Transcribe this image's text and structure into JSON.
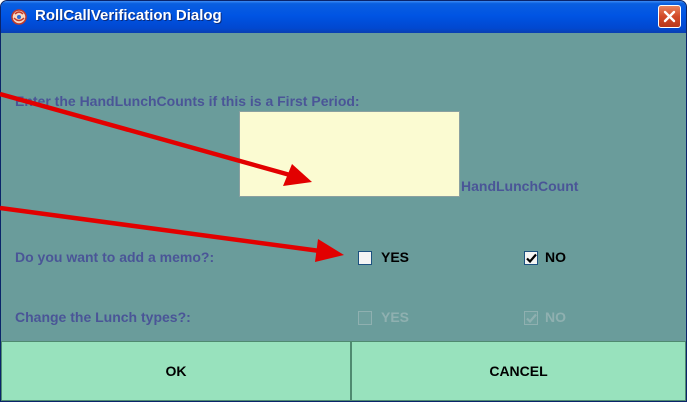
{
  "window": {
    "title": "RollCallVerification Dialog"
  },
  "prompt": {
    "text": "Enter the HandLunchCounts if this is a First Period:"
  },
  "count_field": {
    "value": "",
    "label": "HandLunchCount"
  },
  "memo": {
    "question": "Do you want to add a memo?:",
    "yes_label": "YES",
    "yes_checked": false,
    "no_label": "NO",
    "no_checked": true
  },
  "lunch_types": {
    "question": "Change the Lunch types?:",
    "yes_label": "YES",
    "yes_checked": false,
    "no_label": "NO",
    "no_checked": true,
    "enabled": false
  },
  "buttons": {
    "ok": "OK",
    "cancel": "CANCEL"
  },
  "colors": {
    "dialog_bg": "#6a9c9b",
    "label": "#4a5597",
    "field_bg": "#fbfbd2",
    "button_bg": "#98e2bd",
    "arrow": "#e20000"
  },
  "icons": {
    "app": "app-icon",
    "close": "close-icon",
    "check": "check-icon"
  }
}
